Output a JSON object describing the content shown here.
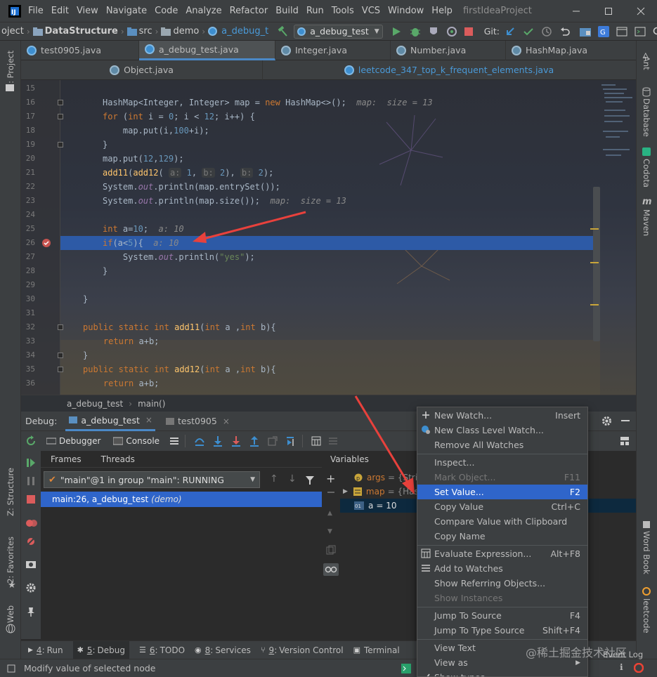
{
  "menubar": {
    "items": [
      "File",
      "Edit",
      "View",
      "Navigate",
      "Code",
      "Analyze",
      "Refactor",
      "Build",
      "Run",
      "Tools",
      "VCS",
      "Window",
      "Help"
    ],
    "project_title": "firstIdeaProject"
  },
  "navbar": {
    "crumbs": [
      "oject",
      "DataStructure",
      "src",
      "demo",
      "a_debug_t"
    ],
    "run_config": "a_debug_test",
    "git_label": "Git:"
  },
  "tabs_row1": [
    "test0905.java",
    "a_debug_test.java",
    "Integer.java",
    "Number.java",
    "HashMap.java"
  ],
  "tabs_row2": [
    "Object.java",
    "leetcode_347_top_k_frequent_elements.java"
  ],
  "left_strip": [
    "1: Project",
    "Z: Structure",
    "2: Favorites",
    "Web"
  ],
  "right_strip": [
    "Ant",
    "Database",
    "Codota",
    "Maven",
    "Word Book",
    "leetcode"
  ],
  "editor": {
    "lines": [
      {
        "n": "15",
        "t": ""
      },
      {
        "n": "16",
        "t": "HashMap<Integer, Integer> map = new HashMap<>();",
        "hint": "map:  size = 13"
      },
      {
        "n": "17",
        "t": "for (int i = 0; i < 12; i++) {"
      },
      {
        "n": "18",
        "t": "    map.put(i,100+i);"
      },
      {
        "n": "19",
        "t": "}"
      },
      {
        "n": "20",
        "t": "map.put(12,129);"
      },
      {
        "n": "21",
        "t": "add11(add12( a: 1, b: 2), b: 2);"
      },
      {
        "n": "22",
        "t": "System.out.println(map.entrySet());"
      },
      {
        "n": "23",
        "t": "System.out.println(map.size());",
        "hint": "map:  size = 13"
      },
      {
        "n": "24",
        "t": ""
      },
      {
        "n": "25",
        "t": "int a=10;",
        "hint": "a: 10"
      },
      {
        "n": "26",
        "t": "if(a<5){",
        "hint": "a: 10"
      },
      {
        "n": "27",
        "t": "    System.out.println(\"yes\");"
      },
      {
        "n": "28",
        "t": "}"
      },
      {
        "n": "29",
        "t": ""
      },
      {
        "n": "30",
        "t": "}"
      },
      {
        "n": "31",
        "t": ""
      },
      {
        "n": "32",
        "t": "public static int add11(int a ,int b){"
      },
      {
        "n": "33",
        "t": "    return a+b;"
      },
      {
        "n": "34",
        "t": "}"
      },
      {
        "n": "35",
        "t": "public static int add12(int a ,int b){"
      },
      {
        "n": "36",
        "t": "    return a+b;"
      }
    ],
    "breadcrumb": [
      "a_debug_test",
      "main()"
    ]
  },
  "debug": {
    "label": "Debug:",
    "tabs": [
      "a_debug_test",
      "test0905"
    ],
    "toolbar_tabs": [
      "Debugger",
      "Console"
    ],
    "frames_tabs": [
      "Frames",
      "Threads"
    ],
    "thread_select": "\"main\"@1 in group \"main\": RUNNING",
    "frame_item": "main:26, a_debug_test",
    "frame_item_pkg": "(demo)",
    "variables_label": "Variables",
    "vars": [
      {
        "name": "args",
        "value": "= {Strin"
      },
      {
        "name": "map",
        "value": "= {Hash"
      },
      {
        "name": "a",
        "value": "= 10"
      }
    ]
  },
  "bottom_tools": [
    {
      "num": "4",
      "label": "Run"
    },
    {
      "num": "5",
      "label": "Debug"
    },
    {
      "num": "6",
      "label": "TODO"
    },
    {
      "num": "8",
      "label": "Services"
    },
    {
      "num": "9",
      "label": "Version Control"
    },
    {
      "num": "",
      "label": "Terminal"
    }
  ],
  "status": {
    "text": "Modify value of selected node",
    "event_log": "Event Log"
  },
  "watermark": "@稀土掘金技术社区",
  "context_menu": [
    {
      "label": "New Watch...",
      "shortcut": "Insert",
      "icon": "plus"
    },
    {
      "label": "New Class Level Watch...",
      "shortcut": "",
      "icon": "watch"
    },
    {
      "label": "Remove All Watches",
      "shortcut": "",
      "icon": ""
    },
    {
      "sep": true
    },
    {
      "label": "Inspect...",
      "shortcut": "",
      "icon": ""
    },
    {
      "label": "Mark Object...",
      "shortcut": "F11",
      "icon": "",
      "disabled": true
    },
    {
      "label": "Set Value...",
      "shortcut": "F2",
      "icon": "",
      "selected": true
    },
    {
      "label": "Copy Value",
      "shortcut": "Ctrl+C",
      "icon": ""
    },
    {
      "label": "Compare Value with Clipboard",
      "shortcut": "",
      "icon": ""
    },
    {
      "label": "Copy Name",
      "shortcut": "",
      "icon": ""
    },
    {
      "sep": true
    },
    {
      "label": "Evaluate Expression...",
      "shortcut": "Alt+F8",
      "icon": "calc"
    },
    {
      "label": "Add to Watches",
      "shortcut": "",
      "icon": "watches"
    },
    {
      "label": "Show Referring Objects...",
      "shortcut": "",
      "icon": ""
    },
    {
      "label": "Show Instances",
      "shortcut": "",
      "icon": "",
      "disabled": true
    },
    {
      "sep": true
    },
    {
      "label": "Jump To Source",
      "shortcut": "F4",
      "icon": ""
    },
    {
      "label": "Jump To Type Source",
      "shortcut": "Shift+F4",
      "icon": ""
    },
    {
      "sep": true
    },
    {
      "label": "View Text",
      "shortcut": "",
      "icon": ""
    },
    {
      "label": "View as",
      "shortcut": "",
      "icon": "",
      "submenu": true
    },
    {
      "label": "Show types",
      "shortcut": "",
      "icon": "check"
    }
  ]
}
